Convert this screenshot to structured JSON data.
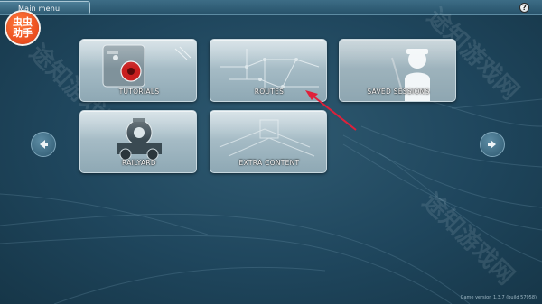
{
  "header": {
    "title": "Main menu",
    "help_label": "?"
  },
  "badge": {
    "line1": "虫虫",
    "line2": "助手"
  },
  "menu": {
    "tiles": [
      {
        "label": "TUTORIALS"
      },
      {
        "label": "ROUTES"
      },
      {
        "label": "SAVED SESSIONS"
      },
      {
        "label": "RAILYARD"
      },
      {
        "label": "EXTRA CONTENT"
      }
    ]
  },
  "watermark": {
    "text": "途知游戏网"
  },
  "footer": {
    "version": "Game version 1.3.7 (build 57958)"
  },
  "colors": {
    "background": "#24506a",
    "annotation_arrow": "#e0203a",
    "badge": "#e84a1c"
  }
}
